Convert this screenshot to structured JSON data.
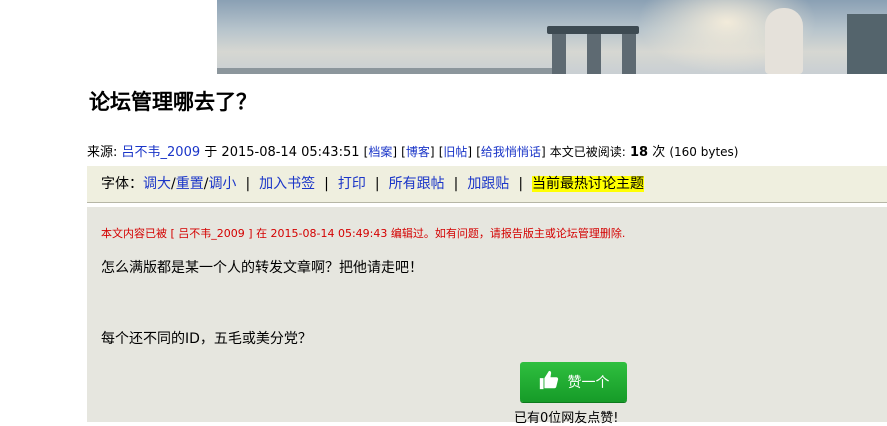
{
  "title": "论坛管理哪去了？",
  "meta": {
    "source_label": "来源:",
    "author": "吕不韦_2009",
    "at_label": "于",
    "datetime": "2015-08-14 05:43:51",
    "links": [
      "档案",
      "博客",
      "旧帖",
      "给我悄悄话"
    ],
    "read_label": "本文已被阅读:",
    "read_count": "18",
    "read_unit": "次",
    "size": "(160 bytes)"
  },
  "toolbar": {
    "font_label": "字体：",
    "font_larger": "调大",
    "font_reset": "重置",
    "font_smaller": "调小",
    "bookmark": "加入书签",
    "print": "打印",
    "all_replies": "所有跟帖",
    "add_reply": "加跟贴",
    "hot_topics": "当前最热讨论主题"
  },
  "content": {
    "notice": "本文内容已被 [ 吕不韦_2009 ] 在 2015-08-14 05:49:43 编辑过。如有问题，请报告版主或论坛管理删除.",
    "para1": "怎么满版都是某一个人的转发文章啊？把他请走吧！",
    "para2": "每个还不同的ID，五毛或美分党？",
    "like_label": "赞一个",
    "like_count_text": "已有0位网友点赞!"
  },
  "colors": {
    "link": "#1a35c8",
    "notice": "#d40000",
    "highlight": "#ffff00",
    "like_green": "#22ad33"
  },
  "icons": {
    "like": "thumbs-up-icon"
  }
}
